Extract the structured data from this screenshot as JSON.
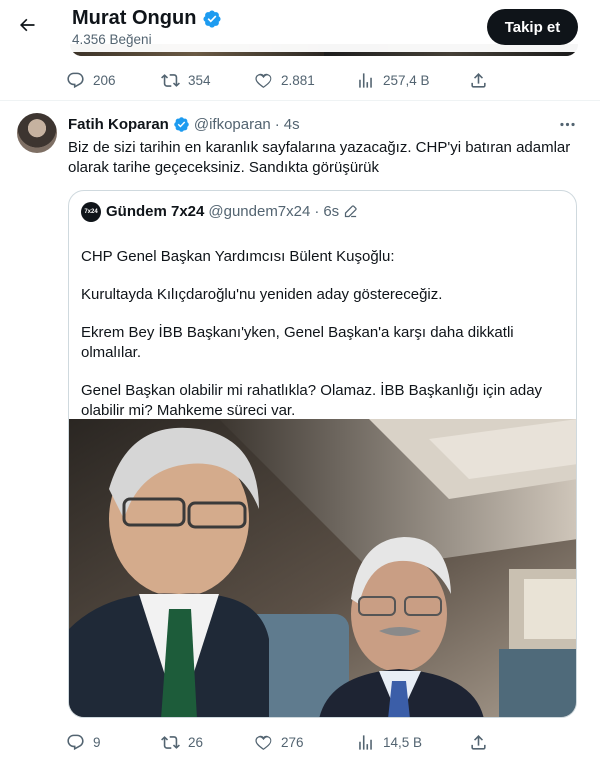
{
  "header": {
    "profile_name": "Murat Ongun",
    "likes_count": "4.356 Beğeni",
    "follow_label": "Takip et"
  },
  "prev_tweet_actions": {
    "replies": "206",
    "retweets": "354",
    "likes": "2.881",
    "views": "257,4 B"
  },
  "tweet": {
    "author_name": "Fatih Koparan",
    "handle": "@ifkoparan",
    "separator": "·",
    "time": "4s",
    "text_lines": [
      "Biz de sizi tarihin en karanlık sayfalarına yazacağız. CHP'yi batıran adamlar",
      "olarak tarihe geçeceksiniz. Sandıkta görüşürük"
    ],
    "quote": {
      "avatar_text": "7x24",
      "author_name": "Gündem 7x24",
      "handle": "@gundem7x24",
      "separator": "·",
      "time": "6s",
      "paragraphs": [
        [
          "CHP Genel Başkan Yardımcısı Bülent Kuşoğlu:"
        ],
        [
          "Kurultayda Kılıçdaroğlu'nu yeniden aday göstereceğiz."
        ],
        [
          "Ekrem Bey İBB Başkanı'yken, Genel Başkan'a karşı daha dikkatli",
          "olmalılar."
        ],
        [
          "Genel Başkan olabilir mi rahatlıkla? Olamaz. İBB Başkanlığı için aday",
          "olabilir mi? Mahkeme süreci var."
        ]
      ]
    },
    "actions": {
      "replies": "9",
      "retweets": "26",
      "likes": "276",
      "views": "14,5 B"
    }
  },
  "colors": {
    "text": "#0f1419",
    "secondary": "#536471",
    "verified": "#1d9bf0",
    "border": "#cfd9de",
    "button_bg": "#0f1419"
  },
  "icons": [
    "back-arrow-icon",
    "verified-badge-icon",
    "reply-icon",
    "retweet-icon",
    "like-icon",
    "views-icon",
    "share-icon",
    "more-icon",
    "edit-icon"
  ]
}
